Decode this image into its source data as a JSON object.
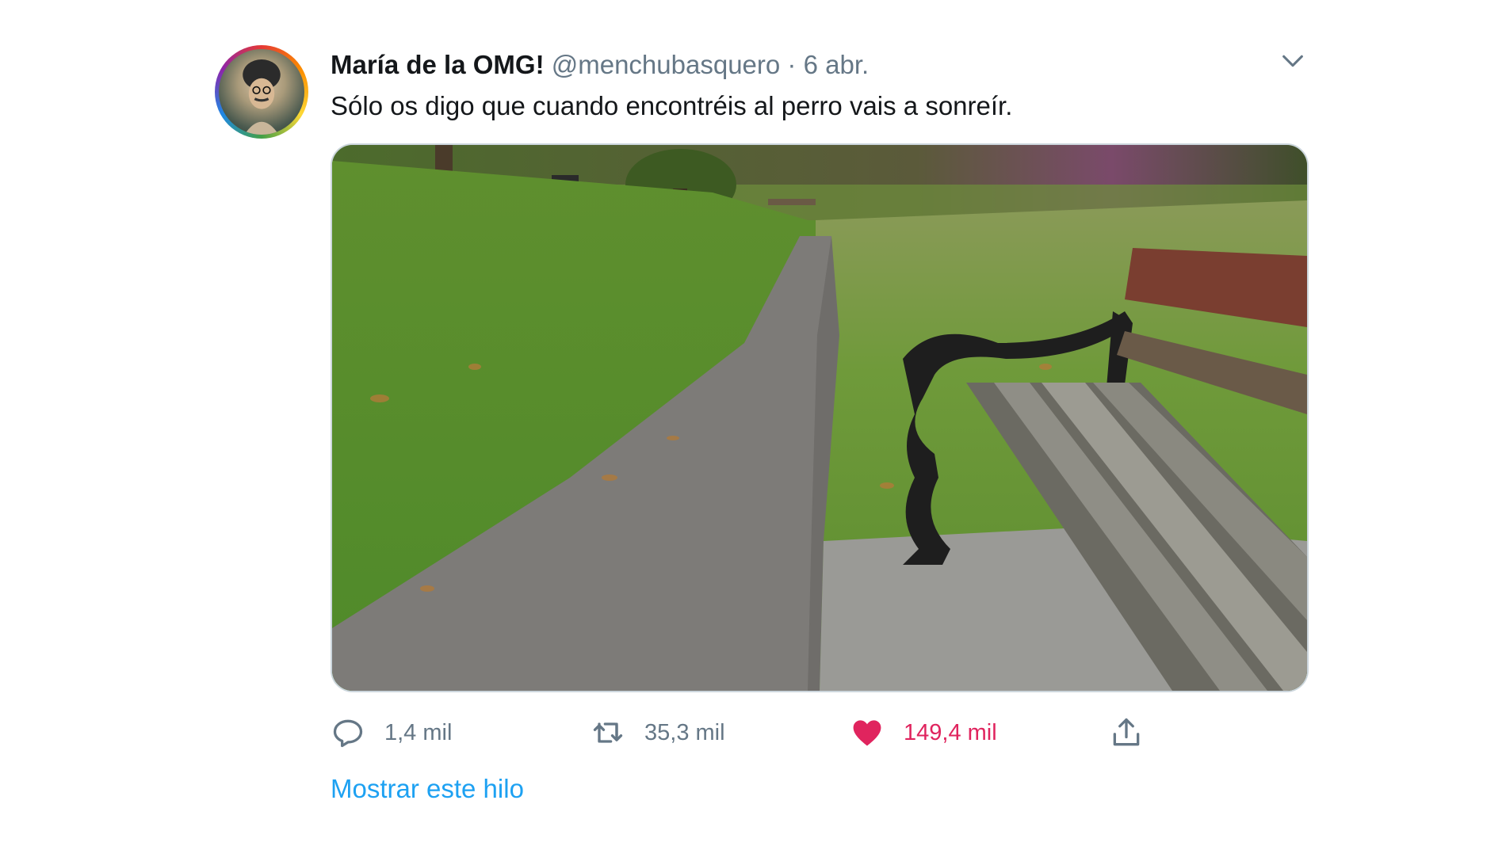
{
  "tweet": {
    "author_name": "María de la OMG!",
    "handle": "@menchubasquero",
    "separator": "·",
    "date": "6 abr.",
    "text": "Sólo os digo que cuando encontréis al perro vais a sonreír.",
    "media_alt": "",
    "actions": {
      "replies": "1,4 mil",
      "retweets": "35,3 mil",
      "likes": "149,4 mil",
      "liked": true
    },
    "show_thread_label": "Mostrar este hilo"
  },
  "icons": {
    "reply": "reply-icon",
    "retweet": "retweet-icon",
    "like": "heart-icon",
    "share": "share-icon",
    "menu": "chevron-down-icon"
  },
  "colors": {
    "text": "#14171a",
    "secondary": "#657786",
    "link": "#1da1f2",
    "like": "#e0245e",
    "border": "#ccd6dd"
  }
}
